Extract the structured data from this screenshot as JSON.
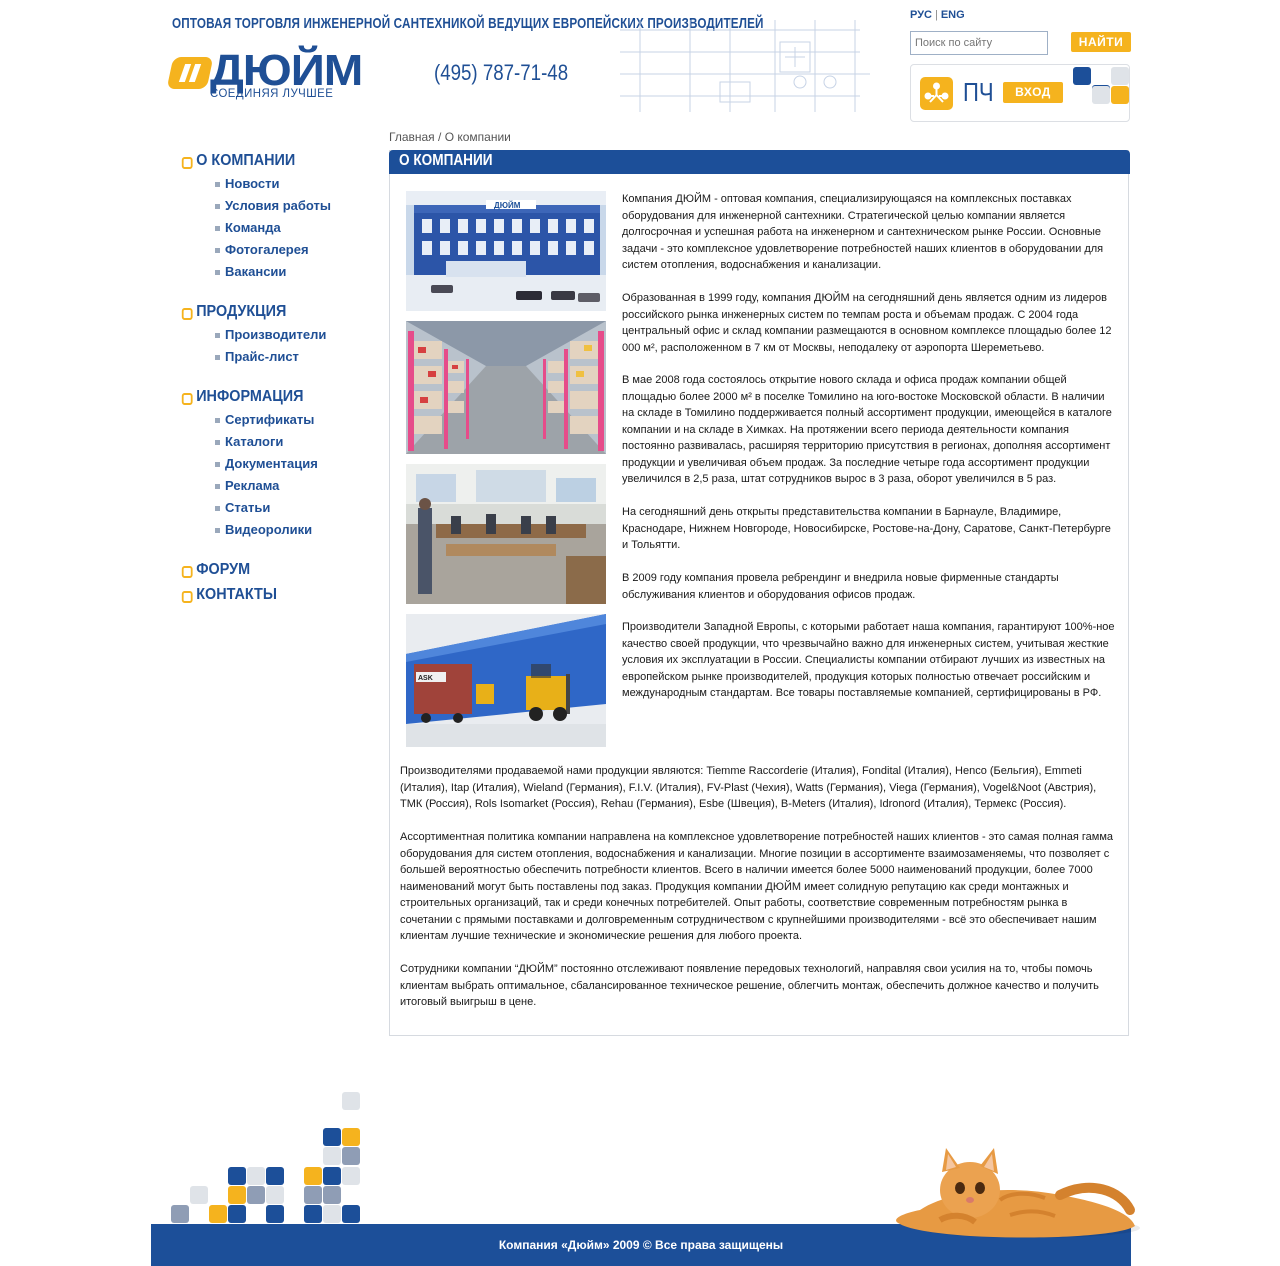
{
  "colors": {
    "brand_blue": "#1c4f99",
    "accent_orange": "#f5b31e",
    "light_gray": "#dfe3e8",
    "mid_gray": "#8f9db5"
  },
  "header": {
    "tagline": "ОПТОВАЯ ТОРГОВЛЯ ИНЖЕНЕРНОЙ САНТЕХНИКОЙ ВЕДУЩИХ ЕВРОПЕЙСКИХ ПРОИЗВОДИТЕЛЕЙ",
    "logo_text": "ДЮЙМ",
    "logo_slogan": "СОЕДИНЯЯ ЛУЧШЕЕ",
    "phone": "(495) 787-71-48",
    "lang_ru": "РУС",
    "lang_en": "ENG",
    "search_placeholder": "Поиск по сайту",
    "search_button": "НАЙТИ",
    "login_icon": "people-network-icon",
    "login_label": "ПЧ",
    "login_button": "ВХОД"
  },
  "sidebar": {
    "sections": [
      {
        "title": "О КОМПАНИИ",
        "items": [
          "Новости",
          "Условия работы",
          "Команда",
          "Фотогалерея",
          "Вакансии"
        ]
      },
      {
        "title": "ПРОДУКЦИЯ",
        "items": [
          "Производители",
          "Прайс-лист"
        ]
      },
      {
        "title": "ИНФОРМАЦИЯ",
        "items": [
          "Сертификаты",
          "Каталоги",
          "Документация",
          "Реклама",
          "Статьи",
          "Видеоролики"
        ]
      },
      {
        "title": "ФОРУМ",
        "items": []
      },
      {
        "title": "КОНТАКТЫ",
        "items": []
      }
    ]
  },
  "breadcrumb": {
    "home": "Главная",
    "separator": " / ",
    "current": "О компании"
  },
  "content": {
    "title": "О КОМПАНИИ",
    "photo_labels": {
      "building_sign": "ДЮЙМ"
    },
    "paragraphs": [
      "Компания ДЮЙМ - оптовая компания, специализирующаяся на комплексных поставках оборудования для инженерной сантехники. Стратегической целью компании является долгосрочная и успешная работа на инженерном и сантехническом рынке России. Основные задачи - это комплексное удовлетворение потребностей наших клиентов в оборудовании для систем отопления, водоснабжения и канализации.",
      "Образованная в 1999 году, компания ДЮЙМ на сегодняшний день является одним из лидеров российского рынка инженерных систем по темпам роста и объемам продаж. С 2004 года центральный офис и склад компании размещаются в основном комплексе площадью более 12 000 м², расположенном в 7 км от Москвы, неподалеку от аэропорта Шереметьево.",
      "В мае 2008 года состоялось открытие нового склада и офиса продаж компании общей площадью более 2000 м² в поселке Томилино на юго-востоке Московской области. В наличии на складе в Томилино поддерживается полный ассортимент продукции, имеющейся в каталоге компании и на складе в Химках. На протяжении всего периода деятельности компания постоянно развивалась, расширяя территорию присутствия в регионах, дополняя ассортимент продукции и увеличивая объем продаж. За последние четыре года ассортимент продукции увеличился в 2,5 раза, штат сотрудников вырос в 3 раза, оборот увеличился в 5 раз.",
      "На сегодняшний день открыты представительства компании в Барнауле, Владимире, Краснодаре, Нижнем Новгороде, Новосибирске, Ростове-на-Дону, Саратове, Санкт-Петербурге и Тольятти.",
      "В 2009 году компания провела ребрендинг и внедрила новые фирменные стандарты обслуживания клиентов и оборудования офисов продаж.",
      "Производители Западной Европы, с которыми работает наша компания, гарантируют 100%-ное качество своей продукции, что чрезвычайно важно для инженерных систем, учитывая жесткие условия их эксплуатации в России. Специалисты компании отбирают лучших из известных на европейском рынке производителей, продукция которых полностью отвечает российским и международным стандартам. Все товары поставляемые компанией, сертифицированы в РФ.",
      "Производителями продаваемой нами продукции являются: Tiemme Raccorderie (Италия), Fondital (Италия), Henco (Бельгия), Emmeti (Италия), Itap (Италия), Wieland (Германия), F.I.V. (Италия), FV-Plast (Чехия), Watts (Германия), Viega (Германия), Vogel&Noot (Австрия), ТМК (Россия), Rols Isomarket (Россия), Rehau (Германия), Esbe (Швеция), B-Meters (Италия), Idronord (Италия), Термекс (Россия).",
      "Ассортиментная политика компании направлена на комплексное удовлетворение потребностей наших клиентов - это самая полная гамма оборудования для систем отопления, водоснабжения и канализации. Многие позиции в ассортименте взаимозаменяемы, что позволяет с большей вероятностью обеспечить потребности клиентов. Всего в наличии имеется более 5000 наименований продукции, более 7000 наименований могут быть поставлены под заказ. Продукция компании ДЮЙМ имеет солидную репутацию как среди монтажных и строительных организаций, так и среди конечных потребителей. Опыт работы, соответствие современным потребностям рынка в сочетании с прямыми поставками и долговременным сотрудничеством с крупнейшими производителями - всё это обеспечивает нашим клиентам лучшие технические и экономические решения для любого проекта.",
      "Сотрудники компании “ДЮЙМ” постоянно отслеживают появление передовых технологий, направляя свои усилия на то, чтобы помочь клиентам выбрать оптимальное, сбалансированное техническое решение, облегчить монтаж, обеспечить должное качество и получить итоговый выигрыш в цене."
    ]
  },
  "footer": {
    "text": "Компания «Дюйм» 2009 © Все права защищены"
  }
}
